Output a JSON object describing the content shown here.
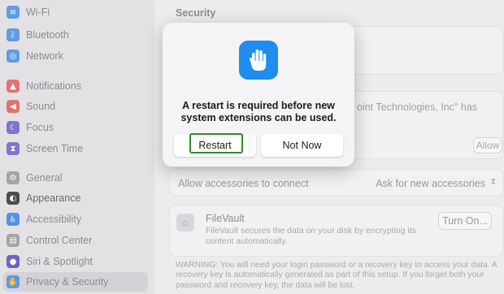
{
  "sidebar": {
    "items": [
      {
        "label": "Wi-Fi",
        "icon": "wifi-icon",
        "color": "#4a90e2"
      },
      {
        "label": "Bluetooth",
        "icon": "bluetooth-icon",
        "color": "#4a90e2"
      },
      {
        "label": "Network",
        "icon": "globe-icon",
        "color": "#4a90e2"
      },
      {
        "label": "Notifications",
        "icon": "bell-icon",
        "color": "#e0605a"
      },
      {
        "label": "Sound",
        "icon": "speaker-icon",
        "color": "#e0605a"
      },
      {
        "label": "Focus",
        "icon": "moon-icon",
        "color": "#6f63c8"
      },
      {
        "label": "Screen Time",
        "icon": "hourglass-icon",
        "color": "#6f63c8"
      },
      {
        "label": "General",
        "icon": "gear-icon",
        "color": "#9b9a9d"
      },
      {
        "label": "Appearance",
        "icon": "appearance-icon",
        "color": "#333333"
      },
      {
        "label": "Accessibility",
        "icon": "accessibility-icon",
        "color": "#3a86e8"
      },
      {
        "label": "Control Center",
        "icon": "control-center-icon",
        "color": "#9b9a9d"
      },
      {
        "label": "Siri & Spotlight",
        "icon": "siri-icon",
        "color": "#5d4bc4"
      },
      {
        "label": "Privacy & Security",
        "icon": "hand-icon",
        "color": "#4a90e2"
      }
    ]
  },
  "main": {
    "section_title": "Security",
    "blocked_text": "oint Technologies, Inc\" has",
    "allow_label": "Allow",
    "accessories_label": "Allow accessories to connect",
    "accessories_value": "Ask for new accessories",
    "filevault_title": "FileVault",
    "filevault_desc": "FileVault secures the data on your disk by encrypting its content automatically.",
    "turn_on_label": "Turn On...",
    "warning": "WARNING: You will need your login password or a recovery key to access your data. A recovery key is automatically generated as part of this setup. If you forget both your password and recovery key, the data will be lost."
  },
  "dialog": {
    "message": "A restart is required before new system extensions can be used.",
    "restart_label": "Restart",
    "not_now_label": "Not Now",
    "icon_color": "#1f8cf0"
  }
}
